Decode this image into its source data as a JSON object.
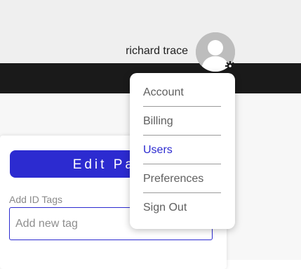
{
  "header": {
    "user_name": "richard trace"
  },
  "user_menu": {
    "items": [
      {
        "label": "Account"
      },
      {
        "label": "Billing"
      },
      {
        "label": "Users",
        "active": true
      },
      {
        "label": "Preferences"
      },
      {
        "label": "Sign Out"
      }
    ]
  },
  "main": {
    "edit_button_label": "Edit Page St",
    "tags_label": "Add ID Tags",
    "tags_placeholder": "Add new tag"
  },
  "colors": {
    "accent": "#2c2bd0",
    "navbar": "#1a1a1a",
    "topbar": "#efefef"
  },
  "icons": {
    "avatar": "user-avatar-icon",
    "settings": "gear-icon"
  }
}
